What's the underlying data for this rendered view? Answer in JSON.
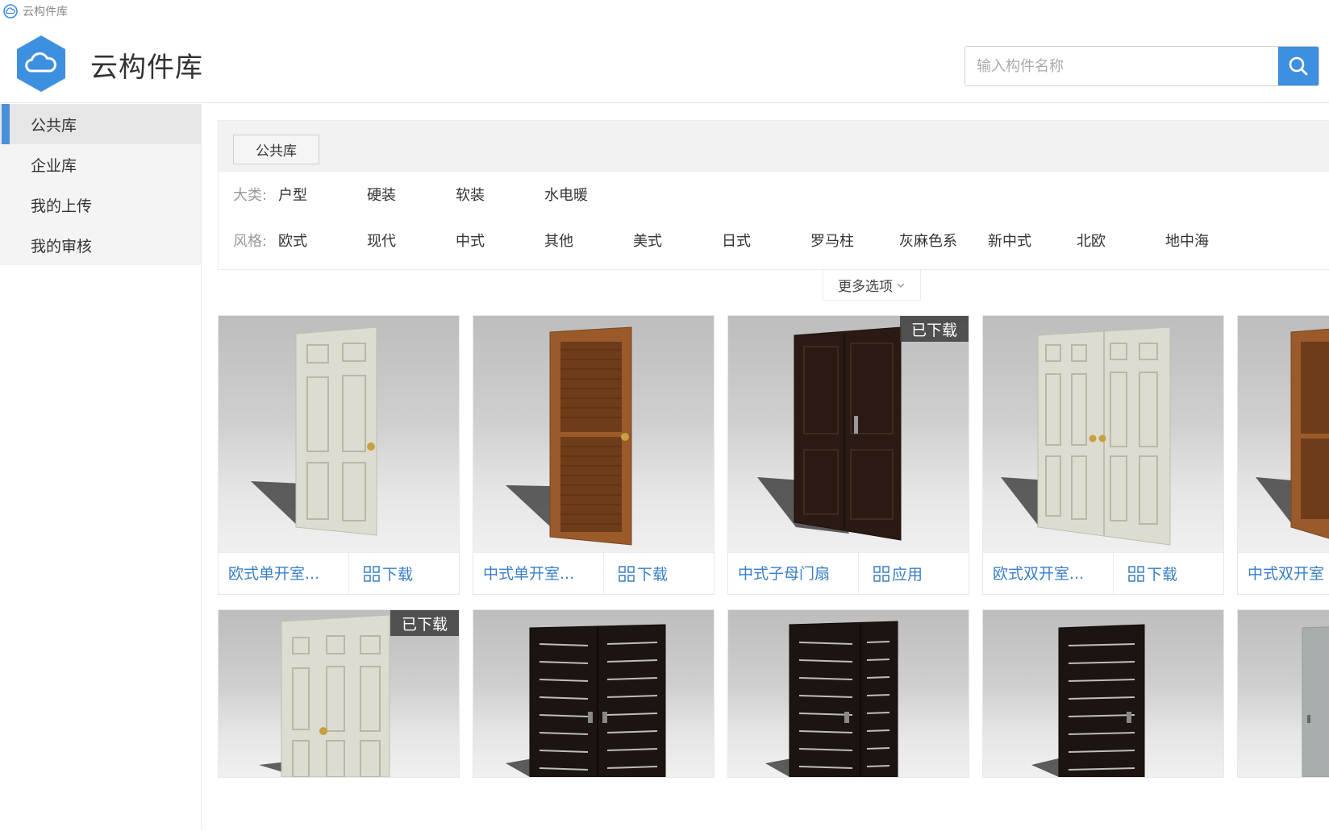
{
  "window": {
    "title": "云构件库"
  },
  "header": {
    "app_title": "云构件库"
  },
  "search": {
    "placeholder": "输入构件名称"
  },
  "sidebar": {
    "items": [
      {
        "label": "公共库",
        "active": true
      },
      {
        "label": "企业库"
      },
      {
        "label": "我的上传"
      },
      {
        "label": "我的审核"
      }
    ]
  },
  "filter": {
    "library_tab": "公共库",
    "category_label": "大类:",
    "categories": [
      "户型",
      "硬装",
      "软装",
      "水电暖"
    ],
    "style_label": "风格:",
    "styles": [
      "欧式",
      "现代",
      "中式",
      "其他",
      "美式",
      "日式",
      "罗马柱",
      "灰麻色系",
      "新中式",
      "北欧",
      "地中海"
    ],
    "more_options": "更多选项"
  },
  "cards": [
    {
      "name": "欧式单开室...",
      "action": "下载",
      "badge": "",
      "door": "white-single"
    },
    {
      "name": "中式单开室...",
      "action": "下载",
      "badge": "",
      "door": "brown-single"
    },
    {
      "name": "中式子母门扇",
      "action": "应用",
      "badge": "已下载",
      "door": "dark-double"
    },
    {
      "name": "欧式双开室...",
      "action": "下载",
      "badge": "",
      "door": "white-double"
    },
    {
      "name": "中式双开室",
      "action": "",
      "badge": "",
      "door": "brown-partial"
    },
    {
      "name": "",
      "action": "",
      "badge": "已下载",
      "door": "white-single-2"
    },
    {
      "name": "",
      "action": "",
      "badge": "",
      "door": "black-striped-double"
    },
    {
      "name": "",
      "action": "",
      "badge": "",
      "door": "black-striped-asym"
    },
    {
      "name": "",
      "action": "",
      "badge": "",
      "door": "black-striped-single"
    },
    {
      "name": "",
      "action": "",
      "badge": "",
      "door": "grey-partial"
    }
  ],
  "colors": {
    "accent": "#3d8fe0",
    "link": "#3a7fc6",
    "sidebar_active_bar": "#4a90d9"
  }
}
